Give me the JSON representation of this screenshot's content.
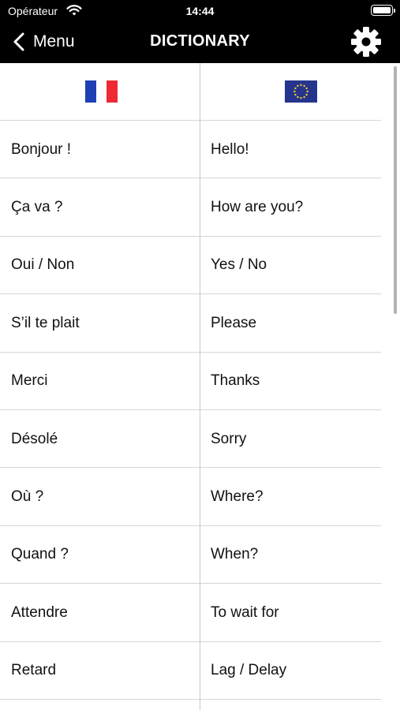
{
  "status_bar": {
    "carrier": "Opérateur",
    "time": "14:44"
  },
  "nav": {
    "back_label": "Menu",
    "title": "DICTIONARY"
  },
  "columns": {
    "left_flag": "france-flag",
    "right_flag": "eu-flag"
  },
  "colors": {
    "fr_blue": "#1f3fb4",
    "fr_white": "#ffffff",
    "fr_red": "#ee2a32",
    "eu_blue": "#25358d",
    "eu_star": "#f5d21f"
  },
  "rows": [
    {
      "fr": "Bonjour !",
      "en": "Hello!"
    },
    {
      "fr": "Ça va ?",
      "en": "How are you?"
    },
    {
      "fr": "Oui / Non",
      "en": "Yes / No"
    },
    {
      "fr": "S’il te plait",
      "en": "Please"
    },
    {
      "fr": "Merci",
      "en": "Thanks"
    },
    {
      "fr": "Désolé",
      "en": "Sorry"
    },
    {
      "fr": "Où ?",
      "en": "Where?"
    },
    {
      "fr": "Quand ?",
      "en": "When?"
    },
    {
      "fr": "Attendre",
      "en": "To wait for"
    },
    {
      "fr": "Retard",
      "en": "Lag / Delay"
    }
  ]
}
